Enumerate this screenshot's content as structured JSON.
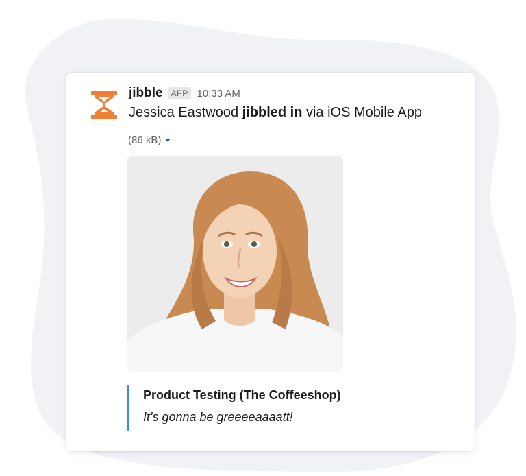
{
  "message": {
    "app_name": "jibble",
    "app_badge": "APP",
    "time": "10:33 AM",
    "user": "Jessica Eastwood",
    "action": "jibbled in",
    "via": "via iOS Mobile App",
    "file_size": "(86 kB)",
    "logo_icon": "jibble-hourglass-logo-icon",
    "photo_icon": "user-photo",
    "attachment": {
      "title": "Product Testing (The Coffeeshop)",
      "text": "It's gonna be greeeeaaaatt!"
    }
  },
  "colors": {
    "brand_orange": "#f07e35",
    "attachment_bar": "#3d8fd6",
    "background_blob": "#f0f2f6"
  }
}
